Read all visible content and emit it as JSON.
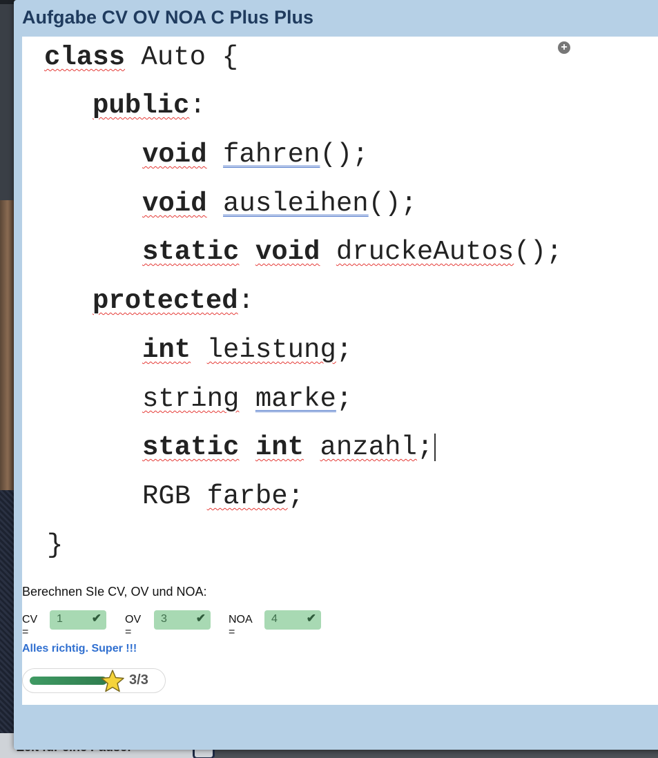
{
  "dialog": {
    "title": "Aufgabe CV OV NOA C Plus Plus"
  },
  "code": {
    "lines": [
      "class Auto {",
      "public:",
      "void fahren();",
      "void ausleihen();",
      "static void druckeAutos();",
      "protected:",
      "int leistung;",
      "string marke;",
      "static int anzahl;",
      "RGB farbe;",
      "}"
    ]
  },
  "question": {
    "prompt": "Berechnen SIe CV, OV und NOA:",
    "fields": [
      {
        "label": "CV =",
        "value": "1",
        "status": "correct"
      },
      {
        "label": "OV =",
        "value": "3",
        "status": "correct"
      },
      {
        "label": "NOA =",
        "value": "4",
        "status": "correct"
      }
    ],
    "feedback": "Alles richtig. Super !!!"
  },
  "progress": {
    "current": "3",
    "separator": "/",
    "total": "3",
    "fraction": 1.0
  },
  "background": {
    "bottom_label": "Zeit für eine Pause!"
  },
  "colors": {
    "title": "#1f3b5e",
    "feedback": "#2f6fd0",
    "answer_box": "#a8d9b3",
    "progress": "#3f9a63"
  },
  "icons": [
    "add-icon",
    "check-icon",
    "star-icon"
  ]
}
